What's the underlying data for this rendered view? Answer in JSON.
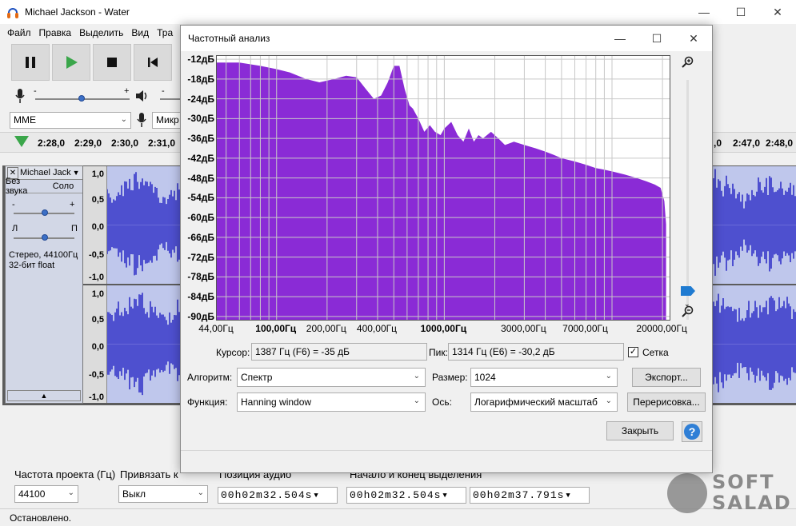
{
  "app": {
    "title": "Michael Jackson - Water",
    "menu": [
      "Файл",
      "Правка",
      "Выделить",
      "Вид",
      "Тра"
    ]
  },
  "toolbar": {
    "host": "MME",
    "mic_device": "Микр"
  },
  "timeline": {
    "ticks": [
      "2:28,0",
      "2:29,0",
      "2:30,0",
      "2:31,0"
    ],
    "ticks_right": [
      ",0",
      "2:47,0",
      "2:48,0"
    ]
  },
  "track": {
    "name": "Michael Jack",
    "mute": "Без звука",
    "solo": "Соло",
    "pan_left": "Л",
    "pan_right": "П",
    "info_line1": "Стерео, 44100Гц",
    "info_line2": "32-бит float",
    "scale_top": [
      "1,0",
      "0,5",
      "0,0",
      "-0,5",
      "-1,0"
    ],
    "scale_bottom": [
      "1,0",
      "0,5",
      "0,0",
      "-0,5",
      "-1,0"
    ]
  },
  "bottom": {
    "project_rate_label": "Частота проекта (Гц)",
    "project_rate": "44100",
    "snap_label": "Привязать к",
    "snap_value": "Выкл",
    "audio_pos_label": "Позиция аудио",
    "audio_pos": "00h02m32.504s",
    "selection_label": "Начало и конец выделения",
    "sel_start": "00h02m32.504s",
    "sel_end": "00h02m37.791s",
    "status": "Остановлено."
  },
  "watermark": {
    "line1": "SOFT",
    "line2": "SALAD"
  },
  "dialog": {
    "title": "Частотный анализ",
    "cursor_label": "Курсор:",
    "cursor_value": "1387 Гц (F6) = -35 дБ",
    "peak_label": "Пик:",
    "peak_value": "1314 Гц (E6) = -30,2 дБ",
    "grid_label": "Сетка",
    "grid_checked": true,
    "algorithm_label": "Алгоритм:",
    "algorithm_value": "Спектр",
    "size_label": "Размер:",
    "size_value": "1024",
    "export_button": "Экспорт...",
    "function_label": "Функция:",
    "function_value": "Hanning window",
    "axis_label": "Ось:",
    "axis_value": "Логарифмический масштаб",
    "replot_button": "Перерисовка...",
    "close_button": "Закрыть",
    "help_glyph": "?"
  },
  "chart_data": {
    "type": "area",
    "title": "",
    "xlabel": "",
    "ylabel": "",
    "x_scale": "log",
    "xlim": [
      44,
      22050
    ],
    "ylim": [
      -91,
      -11
    ],
    "grid": true,
    "color": "#8a2bd6",
    "x_ticks": [
      "44,00Гц",
      "100,00Гц",
      "200,00Гц",
      "400,00Гц",
      "1000,00Гц",
      "3000,00Гц",
      "7000,00Гц",
      "20000,00Гц"
    ],
    "x_tick_values": [
      44,
      100,
      200,
      400,
      1000,
      3000,
      7000,
      20000
    ],
    "x_tick_bold": [
      false,
      true,
      false,
      false,
      true,
      false,
      false,
      false
    ],
    "y_ticks": [
      "-12дБ",
      "-18дБ",
      "-24дБ",
      "-30дБ",
      "-36дБ",
      "-42дБ",
      "-48дБ",
      "-54дБ",
      "-60дБ",
      "-66дБ",
      "-72дБ",
      "-78дБ",
      "-84дБ",
      "-90дБ"
    ],
    "y_tick_values": [
      -12,
      -18,
      -24,
      -30,
      -36,
      -42,
      -48,
      -54,
      -60,
      -66,
      -72,
      -78,
      -84,
      -90
    ],
    "series": [
      {
        "x": [
          44,
          60,
          80,
          100,
          120,
          150,
          180,
          220,
          260,
          300,
          340,
          380,
          420,
          460,
          500,
          540,
          580,
          620,
          650,
          700,
          760,
          820,
          880,
          950,
          1000,
          1100,
          1200,
          1300,
          1400,
          1500,
          1600,
          1700,
          1900,
          2100,
          2300,
          2600,
          3000,
          3500,
          4000,
          4500,
          5000,
          6000,
          7000,
          8000,
          9000,
          10000,
          12000,
          14000,
          16000,
          18000,
          19500,
          20500,
          21000
        ],
        "y": [
          -13,
          -13,
          -14,
          -15,
          -16,
          -18,
          -19,
          -18,
          -17,
          -17.5,
          -21,
          -24,
          -23,
          -19,
          -14,
          -14,
          -21,
          -26,
          -27,
          -30,
          -34,
          -32,
          -34,
          -35,
          -33,
          -31,
          -35,
          -37,
          -33,
          -37,
          -35,
          -36,
          -34,
          -36,
          -38,
          -37,
          -38,
          -39,
          -40,
          -41,
          -42,
          -43,
          -44,
          -45,
          -45.5,
          -46,
          -47,
          -48,
          -49,
          -50,
          -51,
          -55,
          -62
        ]
      }
    ]
  }
}
